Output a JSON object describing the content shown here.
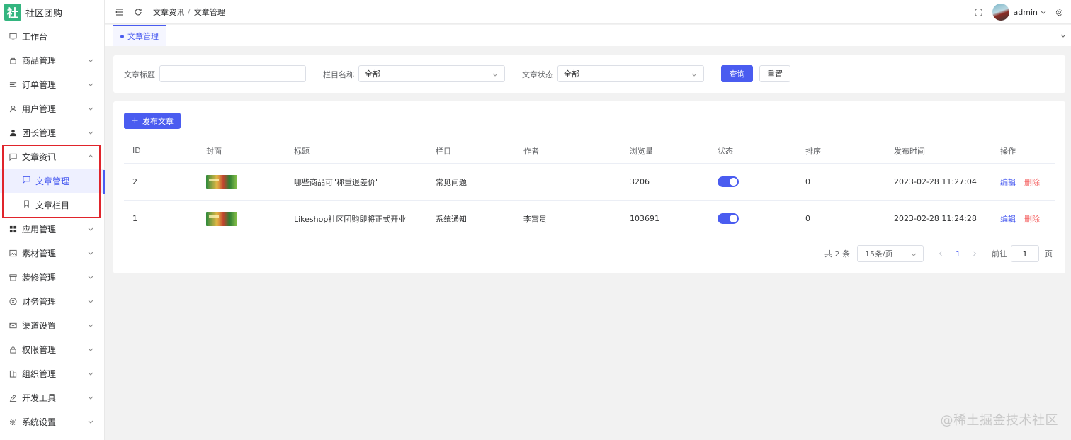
{
  "app": {
    "logo_mark": "社",
    "name": "社区团购"
  },
  "sidebar": {
    "items": [
      {
        "label": "工作台",
        "icon": "monitor-icon",
        "expandable": false
      },
      {
        "label": "商品管理",
        "icon": "shop-icon",
        "expandable": true
      },
      {
        "label": "订单管理",
        "icon": "list-icon",
        "expandable": true
      },
      {
        "label": "用户管理",
        "icon": "user-icon",
        "expandable": true
      },
      {
        "label": "团长管理",
        "icon": "user-filled-icon",
        "expandable": true
      },
      {
        "label": "文章资讯",
        "icon": "message-icon",
        "expandable": true,
        "expanded": true
      },
      {
        "label": "应用管理",
        "icon": "grid-icon",
        "expandable": true
      },
      {
        "label": "素材管理",
        "icon": "picture-icon",
        "expandable": true
      },
      {
        "label": "装修管理",
        "icon": "store-icon",
        "expandable": true
      },
      {
        "label": "财务管理",
        "icon": "finance-icon",
        "expandable": true
      },
      {
        "label": "渠道设置",
        "icon": "mail-icon",
        "expandable": true
      },
      {
        "label": "权限管理",
        "icon": "lock-icon",
        "expandable": true
      },
      {
        "label": "组织管理",
        "icon": "building-icon",
        "expandable": true
      },
      {
        "label": "开发工具",
        "icon": "pen-icon",
        "expandable": true
      },
      {
        "label": "系统设置",
        "icon": "gear-icon",
        "expandable": true
      }
    ],
    "sub_items": [
      {
        "label": "文章管理",
        "icon": "chat-icon",
        "active": true
      },
      {
        "label": "文章栏目",
        "icon": "bookmark-icon",
        "active": false
      }
    ]
  },
  "topbar": {
    "breadcrumb": [
      "文章资讯",
      "文章管理"
    ],
    "user": "admin"
  },
  "tabs": [
    {
      "label": "文章管理",
      "active": true
    }
  ],
  "filters": {
    "title_label": "文章标题",
    "title_value": "",
    "column_label": "栏目名称",
    "column_value": "全部",
    "status_label": "文章状态",
    "status_value": "全部",
    "search_label": "查询",
    "reset_label": "重置"
  },
  "table": {
    "publish_label": "发布文章",
    "headers": [
      "ID",
      "封面",
      "标题",
      "栏目",
      "作者",
      "浏览量",
      "状态",
      "排序",
      "发布时间",
      "操作"
    ],
    "rows": [
      {
        "id": "2",
        "title": "哪些商品可\"称重退差价\"",
        "column": "常见问题",
        "author": "",
        "views": "3206",
        "status_on": true,
        "sort": "0",
        "time": "2023-02-28 11:27:04",
        "edit": "编辑",
        "delete": "删除"
      },
      {
        "id": "1",
        "title": "Likeshop社区团购即将正式开业",
        "column": "系统通知",
        "author": "李富贵",
        "views": "103691",
        "status_on": true,
        "sort": "0",
        "time": "2023-02-28 11:24:28",
        "edit": "编辑",
        "delete": "删除"
      }
    ]
  },
  "pagination": {
    "total": "共 2 条",
    "page_size": "15条/页",
    "current_page": "1",
    "goto_label": "前往",
    "goto_value": "1",
    "page_suffix": "页"
  },
  "watermark": "@稀土掘金技术社区",
  "colors": {
    "primary": "#4a5cf0",
    "danger": "#f56c6c",
    "logo": "#33b57f",
    "highlight": "#e0242b"
  }
}
